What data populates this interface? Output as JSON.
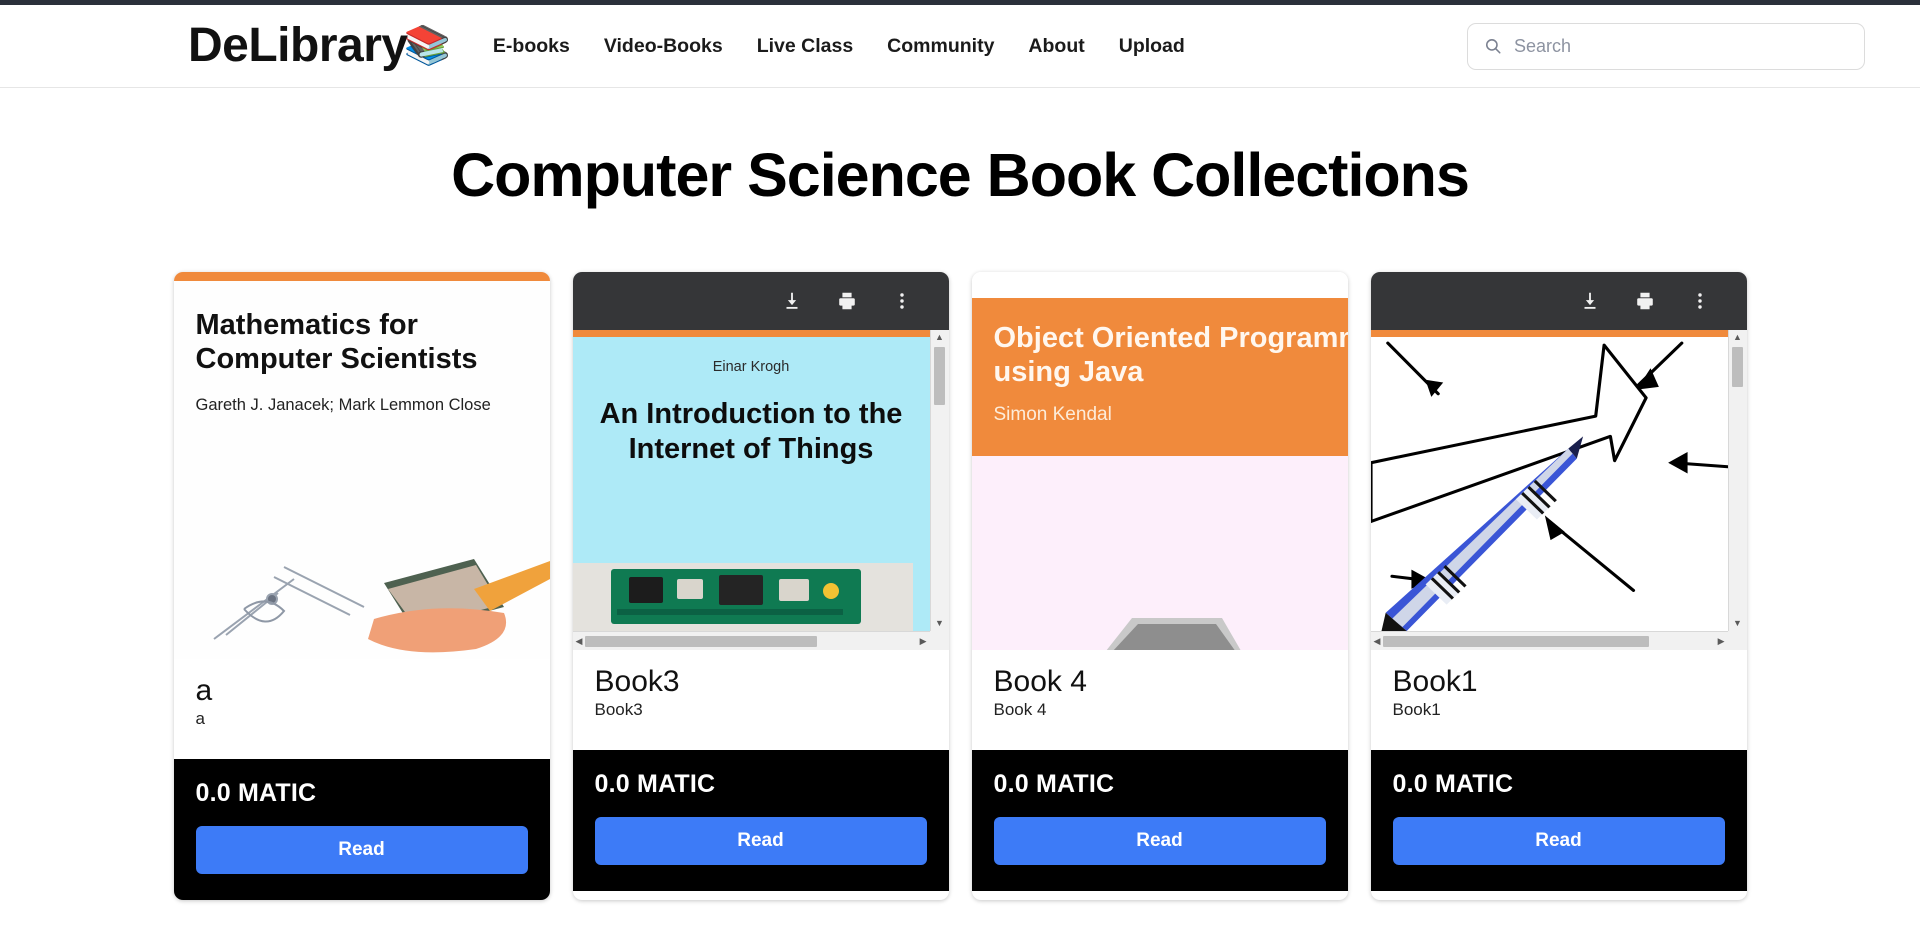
{
  "header": {
    "brand_name": "DeLibrary",
    "brand_icon": "📚",
    "nav": [
      {
        "label": "E-books"
      },
      {
        "label": "Video-Books"
      },
      {
        "label": "Live Class"
      },
      {
        "label": "Community"
      },
      {
        "label": "About"
      },
      {
        "label": "Upload"
      }
    ],
    "search": {
      "placeholder": "Search",
      "value": "",
      "icon": "search-icon"
    }
  },
  "main": {
    "page_title": "Computer Science Book Collections"
  },
  "pdf_toolbar": {
    "download_label": "Download",
    "print_label": "Print",
    "more_label": "More actions"
  },
  "colors": {
    "accent_orange": "#f08a3c",
    "read_button": "#3d7bf7",
    "footer_bg": "#000000",
    "toolbar_bg": "#353638"
  },
  "cards": [
    {
      "title": "a",
      "subtitle": "a",
      "price": "0.0 MATIC",
      "read_label": "Read",
      "has_toolbar": false,
      "cover": {
        "type": "math",
        "heading_line1": "Mathematics for",
        "heading_line2": "Computer Scientists",
        "authors": "Gareth J. Janacek; Mark Lemmon Close"
      }
    },
    {
      "title": "Book3",
      "subtitle": "Book3",
      "price": "0.0 MATIC",
      "read_label": "Read",
      "has_toolbar": true,
      "cover": {
        "type": "iot",
        "author": "Einar Krogh",
        "heading": "An Introduction to the Internet of Things"
      }
    },
    {
      "title": "Book 4",
      "subtitle": "Book 4",
      "price": "0.0 MATIC",
      "read_label": "Read",
      "has_toolbar": false,
      "cover": {
        "type": "oop",
        "heading_line1": "Object Oriented Programming",
        "heading_line2": "using Java",
        "author": "Simon Kendal"
      }
    },
    {
      "title": "Book1",
      "subtitle": "Book1",
      "price": "0.0 MATIC",
      "read_label": "Read",
      "has_toolbar": true,
      "cover": {
        "type": "pen"
      }
    }
  ]
}
